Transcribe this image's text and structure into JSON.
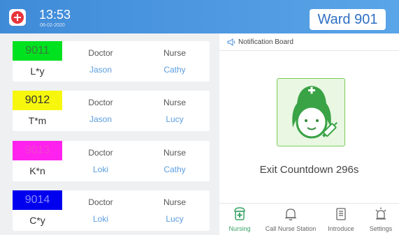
{
  "header": {
    "time": "13:53",
    "date": "06-02-2020",
    "ward": "Ward 901",
    "logo_icon": "hospital-cross-icon"
  },
  "rooms": [
    {
      "number": "9011",
      "patient": "L*y",
      "doctor_label": "Doctor",
      "doctor": "Jason",
      "nurse_label": "Nurse",
      "nurse": "Cathy",
      "color": "#00e11f",
      "number_color": "#3a7a3a"
    },
    {
      "number": "9012",
      "patient": "T*m",
      "doctor_label": "Doctor",
      "doctor": "Jason",
      "nurse_label": "Nurse",
      "nurse": "Lucy",
      "color": "#f7f70e",
      "number_color": "#333333"
    },
    {
      "number": "9013",
      "patient": "K*n",
      "doctor_label": "Doctor",
      "doctor": "Loki",
      "nurse_label": "Nurse",
      "nurse": "Cathy",
      "color": "#ff22ee",
      "number_color": "#ee44cc"
    },
    {
      "number": "9014",
      "patient": "C*y",
      "doctor_label": "Doctor",
      "doctor": "Loki",
      "nurse_label": "Nurse",
      "nurse": "Lucy",
      "color": "#0000ee",
      "number_color": "#8a8aff"
    }
  ],
  "notice": {
    "label": "Notification Board",
    "icon": "speaker-icon"
  },
  "countdown": "Exit Countdown 296s",
  "nav": {
    "items": [
      {
        "label": "Nursing",
        "icon": "nurse-badge-icon",
        "active": true
      },
      {
        "label": "Call Nurse Station",
        "icon": "bell-icon"
      },
      {
        "label": "Introduce",
        "icon": "document-icon"
      },
      {
        "label": "Settings",
        "icon": "alarm-light-icon"
      }
    ]
  },
  "colors": {
    "header_start": "#3f8bd8",
    "header_end": "#5aa4e8",
    "staff_blue": "#5b9ee0",
    "accent_green": "#3aa366"
  }
}
